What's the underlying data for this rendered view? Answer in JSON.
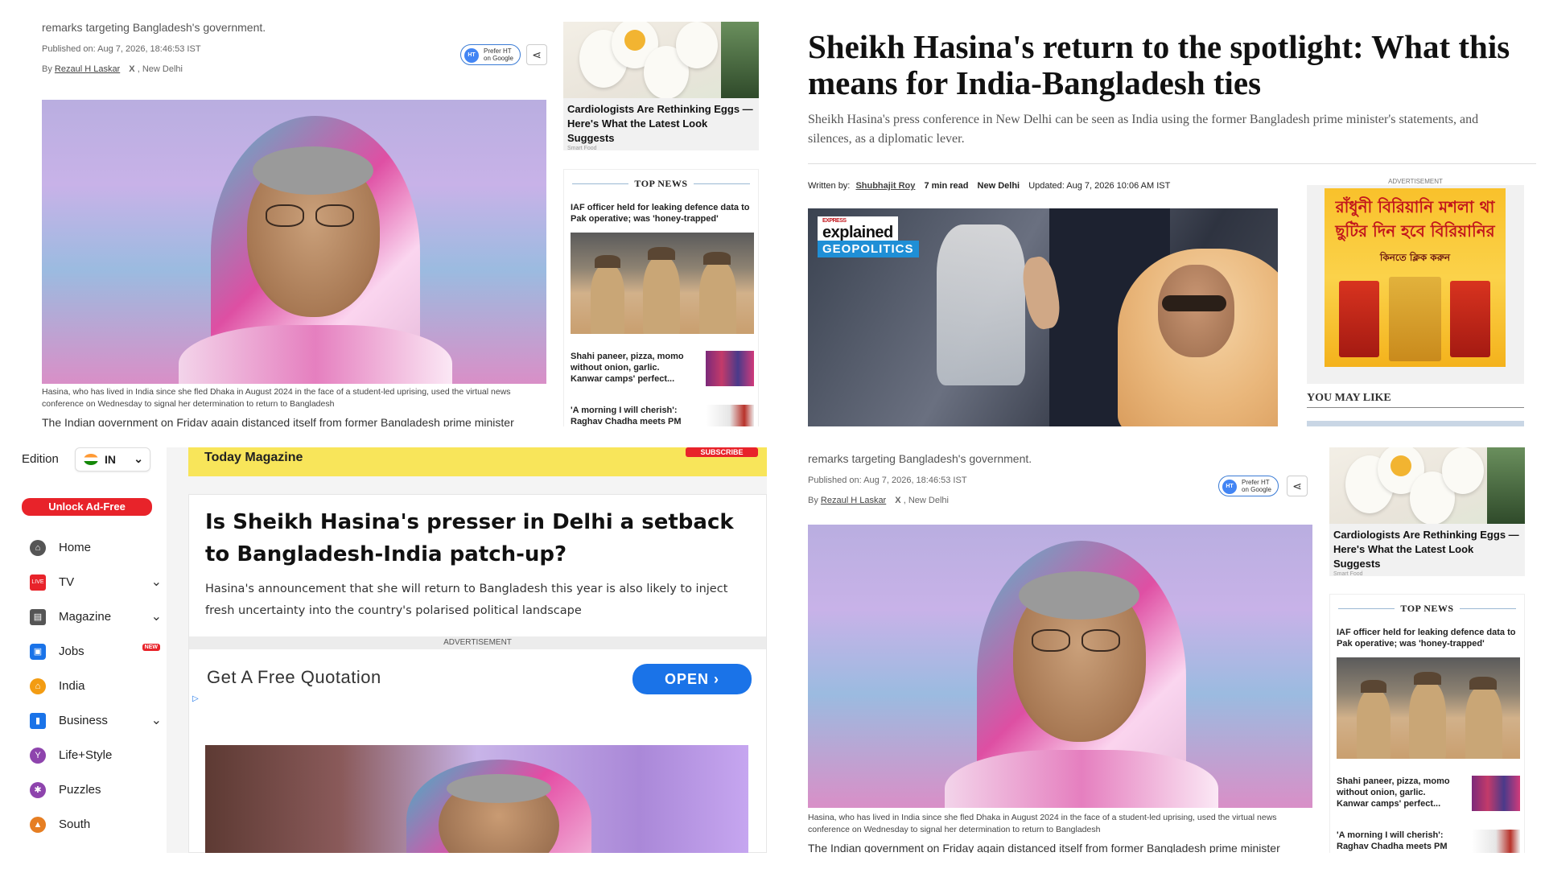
{
  "panel_a": {
    "top_text": "remarks targeting Bangladesh's government.",
    "published": "Published on: Aug 7, 2026, 18:46:53 IST",
    "byline_prefix": "By",
    "author": "Rezaul H Laskar",
    "x_icon": "X",
    "location": ", New Delhi",
    "prefer_line1": "Prefer HT",
    "prefer_line2": "on Google",
    "caption": "Hasina, who has lived in India since she fled Dhaka in August 2024 in the face of a student-led uprising, used the virtual news conference on Wednesday to signal her determination to return to Bangladesh",
    "body_cut": "The Indian government on Friday again distanced itself from former Bangladesh prime minister",
    "egg_title": "Cardiologists Are Rethinking Eggs — Here's What the Latest Look Suggests",
    "egg_source": "Smart Food",
    "top_news_label": "TOP NEWS",
    "top_news": [
      "IAF officer held for leaking defence data to Pak operative; was 'honey-trapped'",
      "Shahi paneer, pizza, momo without onion, garlic. Kanwar camps' perfect...",
      "'A morning I will cherish': Raghav Chadha meets PM"
    ]
  },
  "panel_b": {
    "headline": "Sheikh Hasina's return to the spotlight: What this means for India-Bangladesh ties",
    "subhead": "Sheikh Hasina's press conference in New Delhi can be seen as India using the former Bangladesh prime minister's statements, and silences, as a diplomatic lever.",
    "written_by": "Written by:",
    "author": "Shubhajit Roy",
    "read_time": "7 min read",
    "location": "New Delhi",
    "updated": "Updated: Aug 7, 2026 10:06 AM IST",
    "badge_top": "EXPRESS",
    "badge_main": "explained",
    "badge_geo": "GEOPOLITICS",
    "ad_label": "ADVERTISEMENT",
    "ad_line1": "রাঁধুনী বিরিয়ানি মশলা থা",
    "ad_line2": "ছুটির দিন হবে বিরিয়ানির",
    "ad_cta": "কিনতে ক্লিক করুন",
    "you_may_like": "YOU MAY LIKE"
  },
  "panel_c": {
    "edition_label": "Edition",
    "edition_value": "IN",
    "unlock": "Unlock Ad-Free",
    "nav": [
      {
        "label": "Home",
        "icon": "home-icon",
        "color": "#555555",
        "chevron": false,
        "badge": ""
      },
      {
        "label": "TV",
        "icon": "tv-icon",
        "color": "#e8232a",
        "chevron": true,
        "badge": ""
      },
      {
        "label": "Magazine",
        "icon": "magazine-icon",
        "color": "#555555",
        "chevron": true,
        "badge": ""
      },
      {
        "label": "Jobs",
        "icon": "jobs-icon",
        "color": "#1a73e8",
        "chevron": false,
        "badge": "NEW"
      },
      {
        "label": "India",
        "icon": "india-icon",
        "color": "#f39c12",
        "chevron": false,
        "badge": ""
      },
      {
        "label": "Business",
        "icon": "business-icon",
        "color": "#1a73e8",
        "chevron": true,
        "badge": ""
      },
      {
        "label": "Life+Style",
        "icon": "lifestyle-icon",
        "color": "#8e44ad",
        "chevron": false,
        "badge": ""
      },
      {
        "label": "Puzzles",
        "icon": "puzzles-icon",
        "color": "#8e44ad",
        "chevron": false,
        "badge": ""
      },
      {
        "label": "South",
        "icon": "south-icon",
        "color": "#e67e22",
        "chevron": false,
        "badge": ""
      }
    ],
    "mag_title": "Today Magazine",
    "subscribe": "SUBSCRIBE",
    "headline": "Is Sheikh Hasina's presser in Delhi a setback to Bangladesh-India patch-up?",
    "subhead": "Hasina's announcement that she will return to Bangladesh this year is also likely to inject fresh uncertainty into the country's polarised political landscape",
    "ad_label": "ADVERTISEMENT",
    "ad_text": "Get A Free Quotation",
    "ad_button": "OPEN"
  },
  "panel_d": {
    "top_text": "remarks targeting Bangladesh's government.",
    "published": "Published on: Aug 7, 2026, 18:46:53 IST",
    "byline_prefix": "By",
    "author": "Rezaul H Laskar",
    "x_icon": "X",
    "location": ", New Delhi",
    "prefer_line1": "Prefer HT",
    "prefer_line2": "on Google",
    "caption": "Hasina, who has lived in India since she fled Dhaka in August 2024 in the face of a student-led uprising, used the virtual news conference on Wednesday to signal her determination to return to Bangladesh",
    "body_cut": "The Indian government on Friday again distanced itself from former Bangladesh prime minister",
    "egg_title": "Cardiologists Are Rethinking Eggs — Here's What the Latest Look Suggests",
    "egg_source": "Smart Food",
    "top_news_label": "TOP NEWS",
    "top_news": [
      "IAF officer held for leaking defence data to Pak operative; was 'honey-trapped'",
      "Shahi paneer, pizza, momo without onion, garlic. Kanwar camps' perfect...",
      "'A morning I will cherish': Raghav Chadha meets PM"
    ]
  }
}
